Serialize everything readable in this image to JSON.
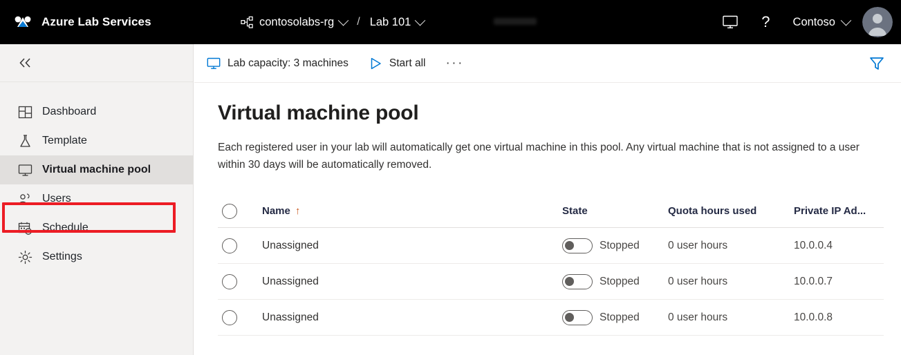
{
  "header": {
    "brand": "Azure Lab Services",
    "logo_icon": "azure-lab-services-logo",
    "breadcrumb": {
      "resource_icon": "resource-group-icon",
      "resource_group": "contosolabs-rg",
      "separator": "/",
      "lab": "Lab 101"
    },
    "redaction_label": "",
    "actions": {
      "cloud_shell_icon": "monitor-icon",
      "help_icon": "question-mark-icon",
      "tenant": "Contoso",
      "avatar_icon": "user-avatar-icon"
    }
  },
  "sidebar": {
    "collapse_icon": "double-chevron-left-icon",
    "items": [
      {
        "label": "Dashboard",
        "icon": "dashboard-grid-icon",
        "active": false
      },
      {
        "label": "Template",
        "icon": "flask-icon",
        "active": false
      },
      {
        "label": "Virtual machine pool",
        "icon": "monitor-icon",
        "active": true
      },
      {
        "label": "Users",
        "icon": "people-icon",
        "active": false
      },
      {
        "label": "Schedule",
        "icon": "calendar-clock-icon",
        "active": false
      },
      {
        "label": "Settings",
        "icon": "gear-icon",
        "active": false
      }
    ],
    "highlight_color": "#ec1c24"
  },
  "commandbar": {
    "capacity_icon": "monitor-icon",
    "capacity_label": "Lab capacity: 3 machines",
    "start_icon": "play-triangle-icon",
    "start_label": "Start all",
    "more_label": "···",
    "filter_icon": "filter-funnel-icon",
    "filter_color": "#0078d4"
  },
  "main": {
    "title": "Virtual machine pool",
    "description": "Each registered user in your lab will automatically get one virtual machine in this pool. Any virtual machine that is not assigned to a user within 30 days will be automatically removed."
  },
  "table": {
    "select_all_name": "select-all-checkbox",
    "columns": [
      {
        "label": "Name",
        "sort": "↑"
      },
      {
        "label": "State"
      },
      {
        "label": "Quota hours used"
      },
      {
        "label": "Private IP Ad..."
      }
    ],
    "rows": [
      {
        "name": "Unassigned",
        "state": "Stopped",
        "toggle_on": false,
        "quota": "0 user hours",
        "ip": "10.0.0.4"
      },
      {
        "name": "Unassigned",
        "state": "Stopped",
        "toggle_on": false,
        "quota": "0 user hours",
        "ip": "10.0.0.7"
      },
      {
        "name": "Unassigned",
        "state": "Stopped",
        "toggle_on": false,
        "quota": "0 user hours",
        "ip": "10.0.0.8"
      }
    ]
  }
}
